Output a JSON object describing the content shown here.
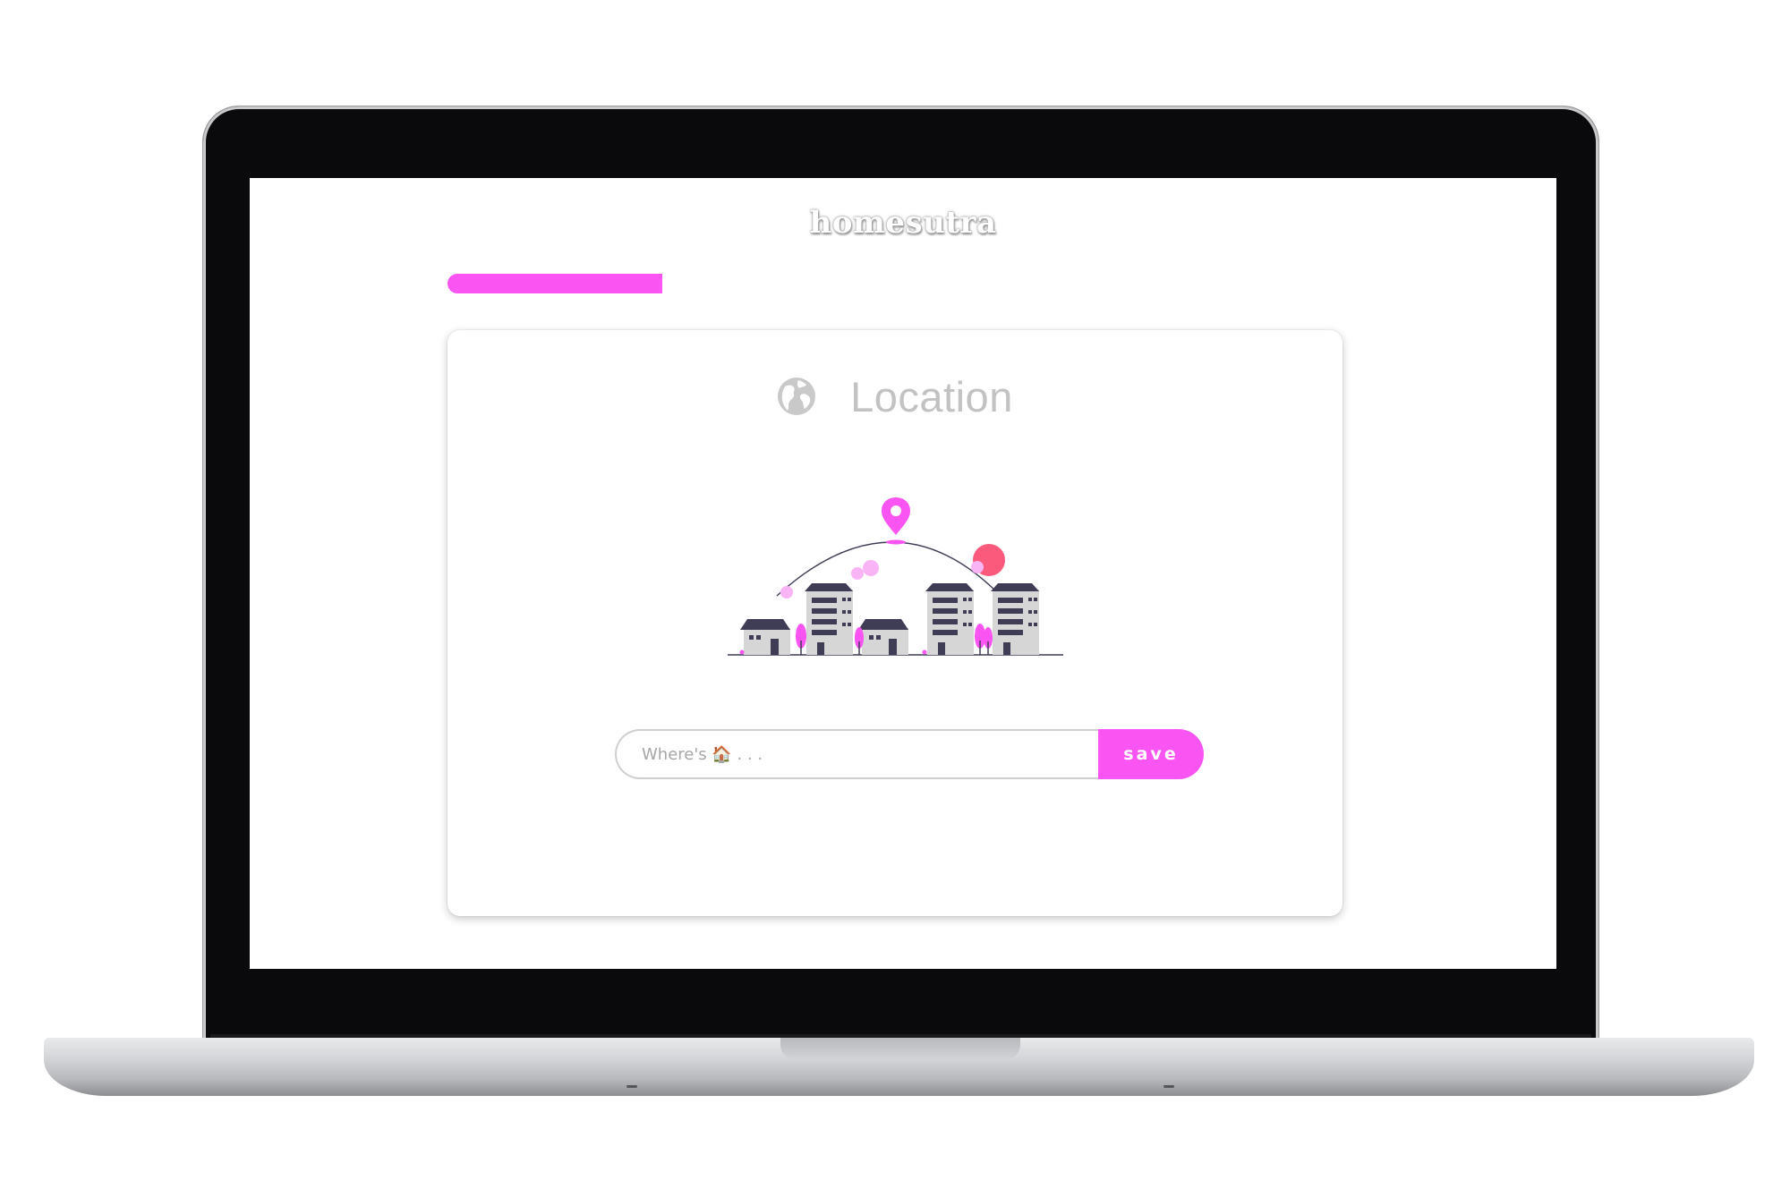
{
  "app": {
    "brand": "homesutra"
  },
  "progress": {
    "value_percent": 24,
    "color": "#fa55f2"
  },
  "card": {
    "icon": "globe-icon",
    "title": "Location",
    "illustration": "city-location-illustration"
  },
  "search": {
    "placeholder": "Where's 🏠 . . .",
    "value": "",
    "save_label": "save"
  },
  "colors": {
    "accent": "#fa55f2",
    "title": "#c2c2c2",
    "building_dark": "#3f3d56",
    "building_light": "#d6d6d6",
    "sun": "#fb5a7c"
  }
}
